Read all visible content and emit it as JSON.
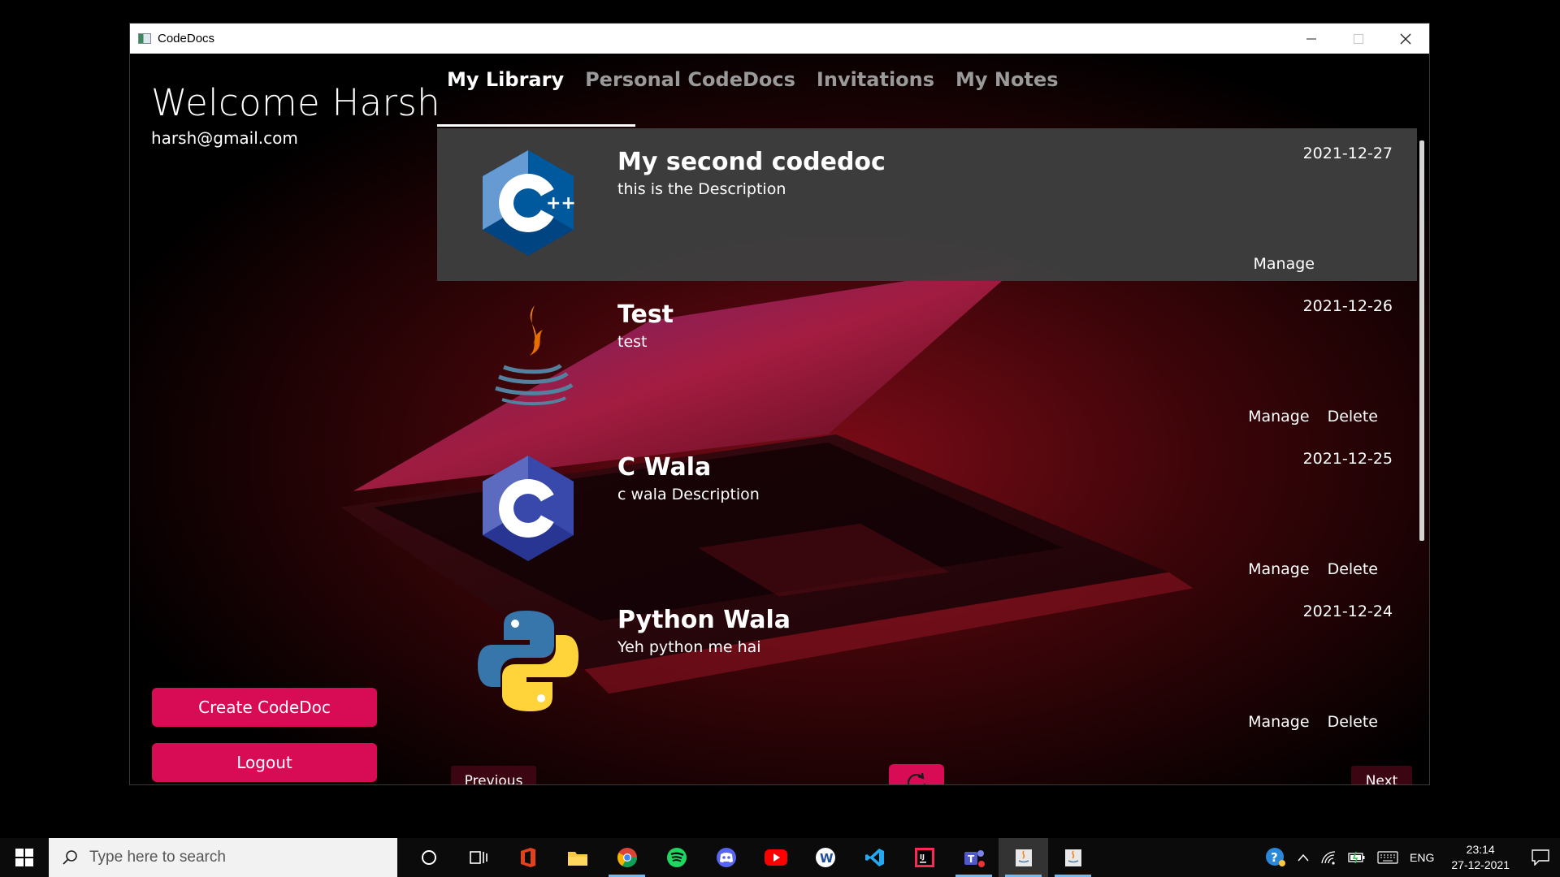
{
  "window": {
    "title": "CodeDocs"
  },
  "sidebar": {
    "welcome": "Welcome Harsh",
    "email": "harsh@gmail.com",
    "create_label": "Create CodeDoc",
    "logout_label": "Logout"
  },
  "tabs": [
    {
      "label": "My Library",
      "active": true
    },
    {
      "label": "Personal CodeDocs",
      "active": false
    },
    {
      "label": "Invitations",
      "active": false
    },
    {
      "label": "My Notes",
      "active": false
    }
  ],
  "docs": [
    {
      "title": "My second codedoc",
      "description": "this is the Description",
      "date": "2021-12-27",
      "logo": "cpp-logo-icon",
      "manage": "Manage",
      "delete": ""
    },
    {
      "title": "Test",
      "description": "test",
      "date": "2021-12-26",
      "logo": "java-logo-icon",
      "manage": "Manage",
      "delete": "Delete"
    },
    {
      "title": "C Wala",
      "description": "c wala Description",
      "date": "2021-12-25",
      "logo": "c-logo-icon",
      "manage": "Manage",
      "delete": "Delete"
    },
    {
      "title": "Python Wala",
      "description": "Yeh python me hai",
      "date": "2021-12-24",
      "logo": "python-logo-icon",
      "manage": "Manage",
      "delete": "Delete"
    }
  ],
  "pager": {
    "previous": "Previous",
    "next": "Next"
  },
  "taskbar": {
    "search_placeholder": "Type here to search",
    "language": "ENG",
    "time": "23:14",
    "date": "27-12-2021"
  },
  "colors": {
    "accent": "#d70c55",
    "pager_bg": "#3b0612",
    "selected_card": "#3e3e3e"
  }
}
